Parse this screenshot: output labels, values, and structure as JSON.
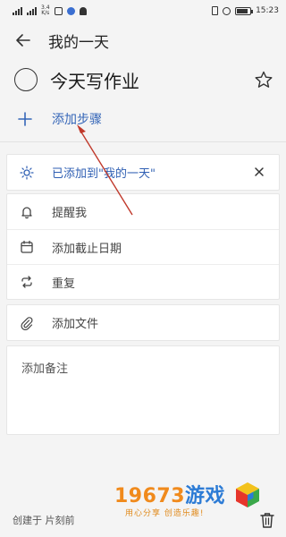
{
  "status_bar": {
    "network_speed_top": "3.4",
    "network_speed_unit": "K/s",
    "time": "15:23"
  },
  "header": {
    "title": "我的一天"
  },
  "task": {
    "title": "今天写作业"
  },
  "add_step": {
    "label": "添加步骤"
  },
  "my_day": {
    "label": "已添加到\"我的一天\""
  },
  "options": {
    "remind": "提醒我",
    "due_date": "添加截止日期",
    "repeat": "重复",
    "add_file": "添加文件"
  },
  "note": {
    "placeholder": "添加备注"
  },
  "footer": {
    "created": "创建于 片刻前"
  },
  "watermark": {
    "number_orange": "19673",
    "number_blue": "游戏",
    "slogan": "用心分享 创造乐趣!"
  },
  "colors": {
    "accent": "#3566b8",
    "annotation_arrow": "#c0392b",
    "watermark_orange": "#f08a1c",
    "watermark_blue": "#2c7bd5"
  }
}
